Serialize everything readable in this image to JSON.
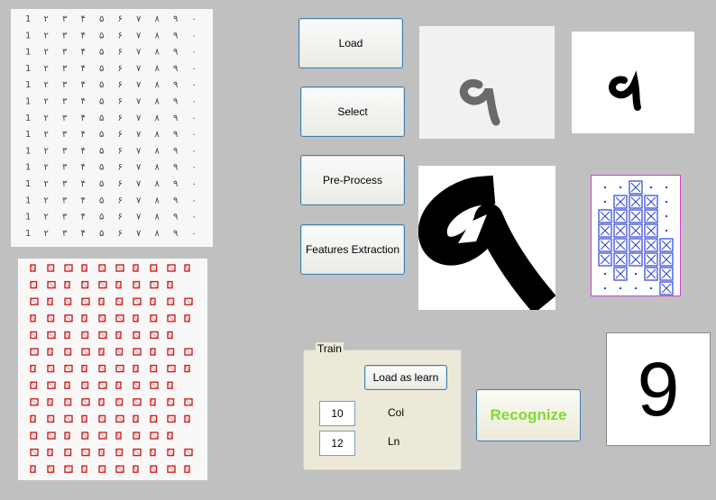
{
  "buttons": {
    "load": "Load",
    "select": "Select",
    "preprocess": "Pre-Process",
    "features": "Features Extraction",
    "load_learn": "Load as learn",
    "recognize": "Recognize"
  },
  "train": {
    "group_label": "Train",
    "col_value": "10",
    "col_label": "Col",
    "ln_value": "12",
    "ln_label": "Ln"
  },
  "result": {
    "digit": "9"
  },
  "colors": {
    "background": "#c0c0c0",
    "recognize_text": "#7ddc2a",
    "segment_boxes": "#cc2222",
    "feature_grid": "#2c3fd8",
    "feature_border": "#d040d0"
  },
  "icons": [
    "digit-sheet-image",
    "segmented-sheet-image",
    "selected-digit-image",
    "binarized-digit-image",
    "preprocessed-digit-image",
    "feature-grid-image"
  ]
}
